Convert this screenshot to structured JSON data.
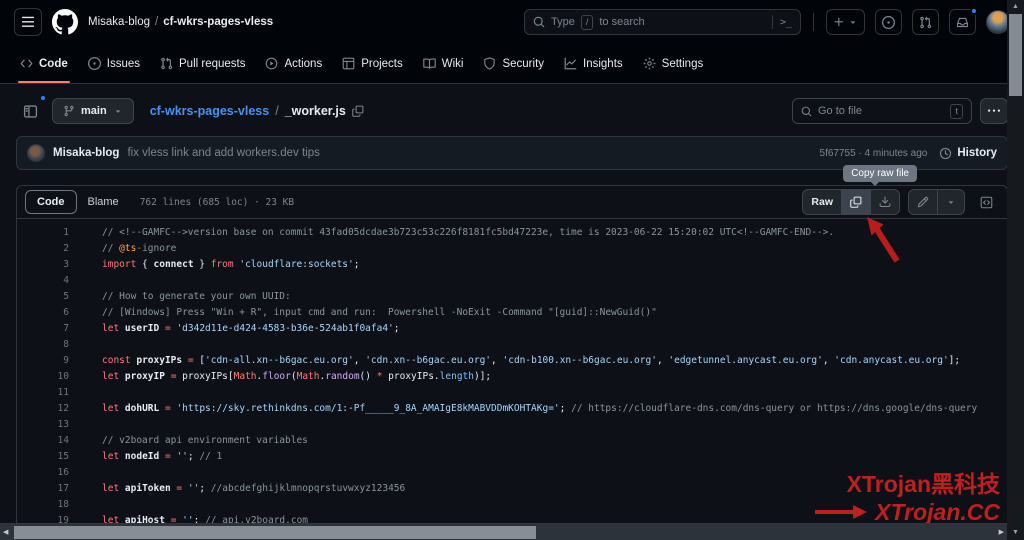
{
  "global_header": {
    "org": "Misaka-blog",
    "separator": "/",
    "repo": "cf-wkrs-pages-vless",
    "search": {
      "placeholder_prefix": "Type",
      "slash_key": "/",
      "placeholder_suffix": "to search",
      "command_palette_glyph": ">_"
    }
  },
  "repo_nav": {
    "tabs": [
      {
        "label": "Code",
        "active": true
      },
      {
        "label": "Issues",
        "active": false
      },
      {
        "label": "Pull requests",
        "active": false
      },
      {
        "label": "Actions",
        "active": false
      },
      {
        "label": "Projects",
        "active": false
      },
      {
        "label": "Wiki",
        "active": false
      },
      {
        "label": "Security",
        "active": false
      },
      {
        "label": "Insights",
        "active": false
      },
      {
        "label": "Settings",
        "active": false
      }
    ]
  },
  "file_header": {
    "branch": "main",
    "repo_link": "cf-wkrs-pages-vless",
    "separator": "/",
    "file_name": "_worker.js",
    "goto_placeholder": "Go to file",
    "goto_key": "t"
  },
  "commit_bar": {
    "author": "Misaka-blog",
    "message": "fix vless link and add workers.dev tips",
    "sha_and_time": "5f67755 · 4 minutes ago",
    "history_label": "History"
  },
  "file_toolbar": {
    "code_tab": "Code",
    "blame_tab": "Blame",
    "stats": "762 lines (685 loc) · 23 KB",
    "raw_label": "Raw",
    "copy_tooltip": "Copy raw file"
  },
  "icons": {
    "hamburger": "three-bars",
    "logo": "github-mark",
    "search": "magnifier",
    "create": "plus-caret",
    "issues": "issue-opened",
    "pull_requests": "git-pull-request",
    "notifications": "inbox",
    "branch": "git-branch",
    "copy": "copy-squares",
    "history": "clock",
    "download": "download-tray",
    "edit": "pencil",
    "symbols": "code-square",
    "more": "kebab-horizontal",
    "file_tree": "sidebar-panel",
    "settings": "gear",
    "security": "shield",
    "insights": "graph",
    "wiki": "book",
    "projects": "table",
    "actions": "play-circle",
    "code": "chevrons"
  },
  "code": {
    "lines": [
      {
        "n": 1,
        "seg": [
          [
            "c",
            "// <!--GAMFC-->version base on commit 43fad05dcdae3b723c53c226f8181fc5bd47223e, time is 2023-06-22 15:20:02 UTC<!--GAMFC-END-->."
          ]
        ]
      },
      {
        "n": 2,
        "seg": [
          [
            "c",
            "// "
          ],
          [
            "o",
            "@ts"
          ],
          [
            "c",
            "-ignore"
          ]
        ]
      },
      {
        "n": 3,
        "seg": [
          [
            "k",
            "import"
          ],
          [
            "p",
            " { "
          ],
          [
            "v",
            "connect"
          ],
          [
            "p",
            " } "
          ],
          [
            "k",
            "from"
          ],
          [
            "p",
            " "
          ],
          [
            "s",
            "'cloudflare:sockets'"
          ],
          [
            "p",
            ";"
          ]
        ]
      },
      {
        "n": 4,
        "seg": []
      },
      {
        "n": 5,
        "seg": [
          [
            "c",
            "// How to generate your own UUID:"
          ]
        ]
      },
      {
        "n": 6,
        "seg": [
          [
            "c",
            "// [Windows] Press \"Win + R\", input cmd and run:  Powershell -NoExit -Command \"[guid]::NewGuid()\""
          ]
        ]
      },
      {
        "n": 7,
        "seg": [
          [
            "k",
            "let"
          ],
          [
            "p",
            " "
          ],
          [
            "v",
            "userID"
          ],
          [
            "p",
            " "
          ],
          [
            "k",
            "="
          ],
          [
            "p",
            " "
          ],
          [
            "s",
            "'d342d11e-d424-4583-b36e-524ab1f0afa4'"
          ],
          [
            "p",
            ";"
          ]
        ]
      },
      {
        "n": 8,
        "seg": []
      },
      {
        "n": 9,
        "seg": [
          [
            "k",
            "const"
          ],
          [
            "p",
            " "
          ],
          [
            "v",
            "proxyIPs"
          ],
          [
            "p",
            " "
          ],
          [
            "k",
            "="
          ],
          [
            "p",
            " ["
          ],
          [
            "s",
            "'cdn-all.xn--b6gac.eu.org'"
          ],
          [
            "p",
            ", "
          ],
          [
            "s",
            "'cdn.xn--b6gac.eu.org'"
          ],
          [
            "p",
            ", "
          ],
          [
            "s",
            "'cdn-b100.xn--b6gac.eu.org'"
          ],
          [
            "p",
            ", "
          ],
          [
            "s",
            "'edgetunnel.anycast.eu.org'"
          ],
          [
            "p",
            ", "
          ],
          [
            "s",
            "'cdn.anycast.eu.org'"
          ],
          [
            "p",
            "];"
          ]
        ]
      },
      {
        "n": 10,
        "seg": [
          [
            "k",
            "let"
          ],
          [
            "p",
            " "
          ],
          [
            "v",
            "proxyIP"
          ],
          [
            "p",
            " "
          ],
          [
            "k",
            "="
          ],
          [
            "p",
            " proxyIPs["
          ],
          [
            "k",
            "Math"
          ],
          [
            "p",
            "."
          ],
          [
            "f",
            "floor"
          ],
          [
            "p",
            "("
          ],
          [
            "k",
            "Math"
          ],
          [
            "p",
            "."
          ],
          [
            "f",
            "random"
          ],
          [
            "p",
            "() "
          ],
          [
            "k",
            "*"
          ],
          [
            "p",
            " proxyIPs."
          ],
          [
            "n",
            "length"
          ],
          [
            "p",
            ")];"
          ]
        ]
      },
      {
        "n": 11,
        "seg": []
      },
      {
        "n": 12,
        "seg": [
          [
            "k",
            "let"
          ],
          [
            "p",
            " "
          ],
          [
            "v",
            "dohURL"
          ],
          [
            "p",
            " "
          ],
          [
            "k",
            "="
          ],
          [
            "p",
            " "
          ],
          [
            "s",
            "'https://sky.rethinkdns.com/1:-Pf_____9_8A_AMAIgE8kMABVDDmKOHTAKg='"
          ],
          [
            "p",
            "; "
          ],
          [
            "c",
            "// https://cloudflare-dns.com/dns-query or https://dns.google/dns-query"
          ]
        ]
      },
      {
        "n": 13,
        "seg": []
      },
      {
        "n": 14,
        "seg": [
          [
            "c",
            "// v2board api environment variables"
          ]
        ]
      },
      {
        "n": 15,
        "seg": [
          [
            "k",
            "let"
          ],
          [
            "p",
            " "
          ],
          [
            "v",
            "nodeId"
          ],
          [
            "p",
            " "
          ],
          [
            "k",
            "="
          ],
          [
            "p",
            " "
          ],
          [
            "s",
            "''"
          ],
          [
            "p",
            "; "
          ],
          [
            "c",
            "// 1"
          ]
        ]
      },
      {
        "n": 16,
        "seg": []
      },
      {
        "n": 17,
        "seg": [
          [
            "k",
            "let"
          ],
          [
            "p",
            " "
          ],
          [
            "v",
            "apiToken"
          ],
          [
            "p",
            " "
          ],
          [
            "k",
            "="
          ],
          [
            "p",
            " "
          ],
          [
            "s",
            "''"
          ],
          [
            "p",
            "; "
          ],
          [
            "c",
            "//abcdefghijklmnopqrstuvwxyz123456"
          ]
        ]
      },
      {
        "n": 18,
        "seg": []
      },
      {
        "n": 19,
        "seg": [
          [
            "k",
            "let"
          ],
          [
            "p",
            " "
          ],
          [
            "v",
            "apiHost"
          ],
          [
            "p",
            " "
          ],
          [
            "k",
            "="
          ],
          [
            "p",
            " "
          ],
          [
            "s",
            "''"
          ],
          [
            "p",
            "; "
          ],
          [
            "c",
            "// api.v2board.com"
          ]
        ]
      }
    ]
  },
  "watermark": {
    "line1": "XTrojan黑科技",
    "line2": "XTrojan.CC"
  },
  "colors": {
    "header_bg": "#010409",
    "page_bg": "#0d1117",
    "border": "#30363d",
    "accent_underline": "#f78166",
    "link": "#4493f8",
    "notification_dot": "#2f81f7",
    "keyword": "#ff7b72",
    "string": "#a5d6ff",
    "comment": "#8b949e",
    "function": "#d2a8ff",
    "constant": "#79c0ff",
    "watermark_red": "#c01f1f",
    "annotation_arrow": "#b91c1c",
    "tooltip_bg": "#6e7681"
  }
}
